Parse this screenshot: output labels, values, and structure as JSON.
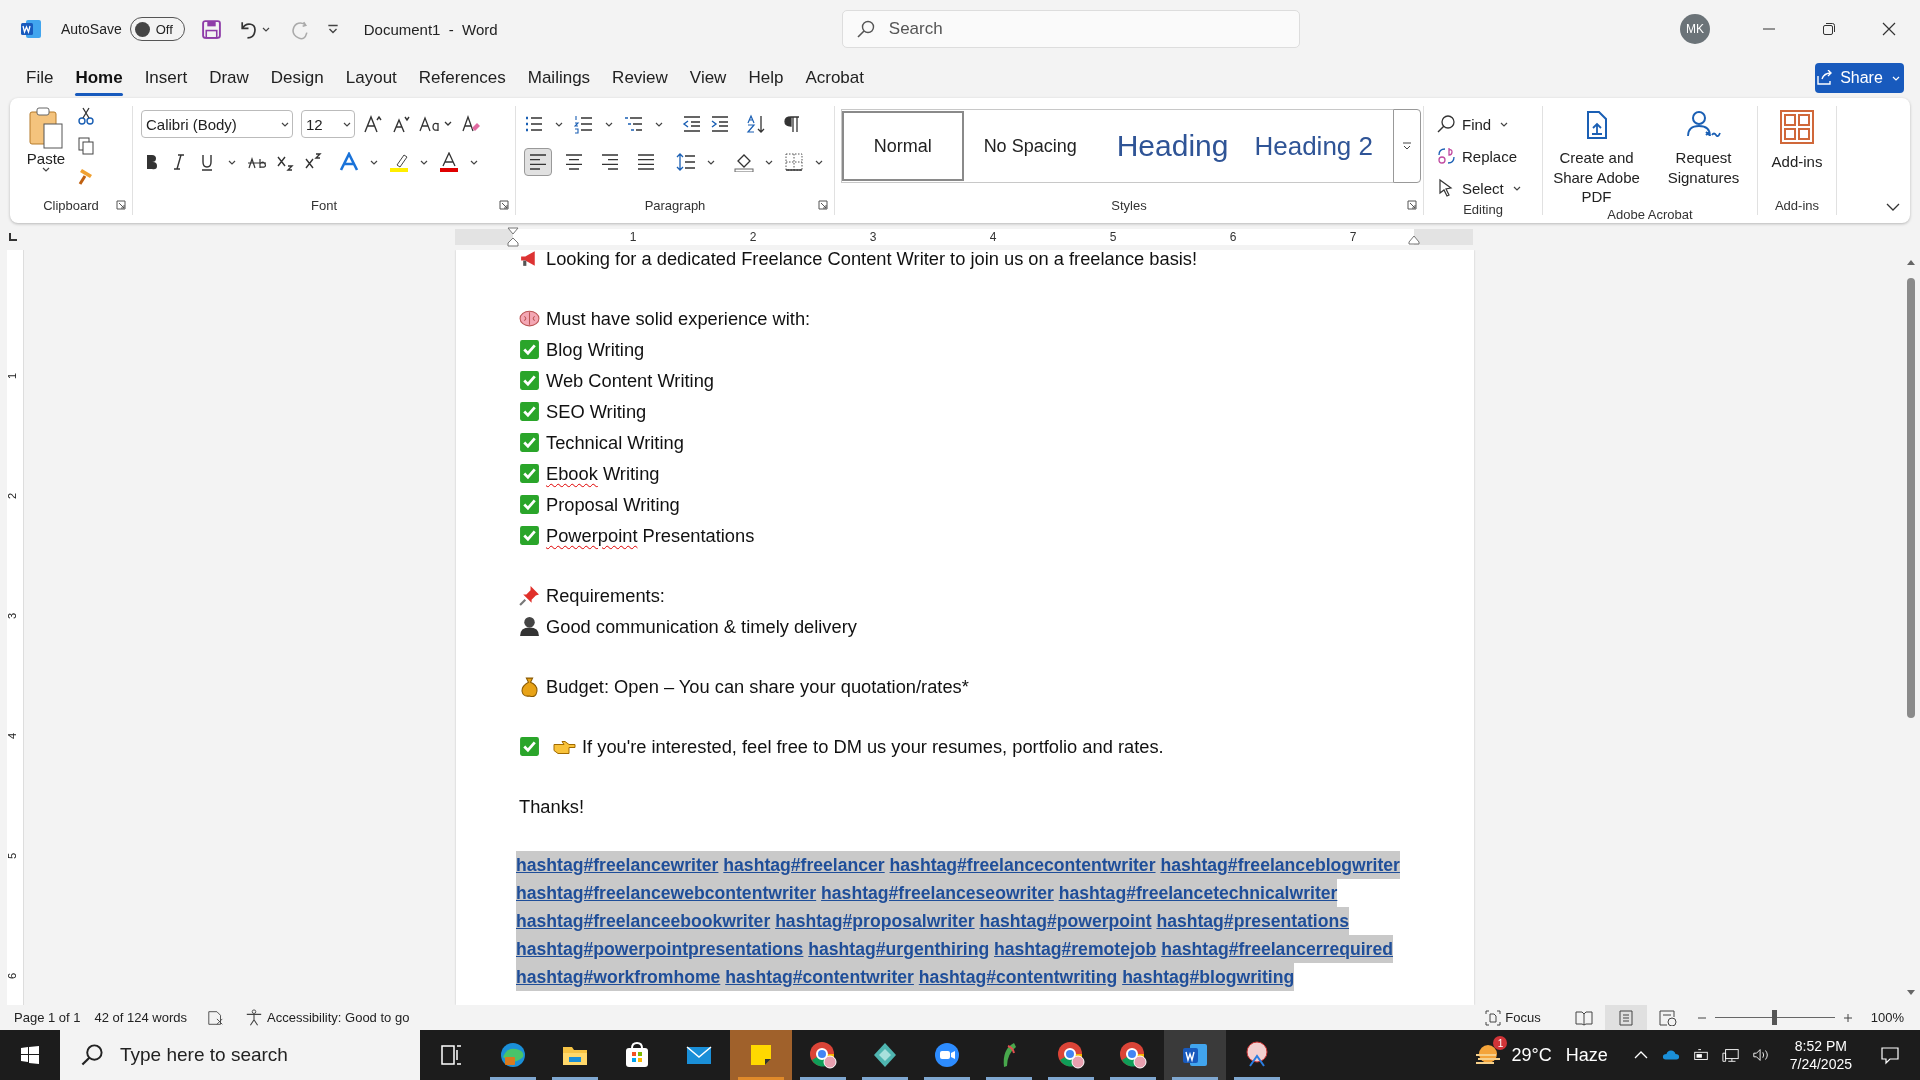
{
  "title_bar": {
    "autosave_label": "AutoSave",
    "autosave": {
      "label": "Off",
      "on": false
    },
    "document_title": "Document1  -  Word",
    "search": {
      "placeholder": "Search"
    },
    "avatar": "MK"
  },
  "menu_tabs": [
    {
      "label": "File",
      "selected": false
    },
    {
      "label": "Home",
      "selected": true
    },
    {
      "label": "Insert",
      "selected": false
    },
    {
      "label": "Draw",
      "selected": false
    },
    {
      "label": "Design",
      "selected": false
    },
    {
      "label": "Layout",
      "selected": false
    },
    {
      "label": "References",
      "selected": false
    },
    {
      "label": "Mailings",
      "selected": false
    },
    {
      "label": "Review",
      "selected": false
    },
    {
      "label": "View",
      "selected": false
    },
    {
      "label": "Help",
      "selected": false
    },
    {
      "label": "Acrobat",
      "selected": false
    }
  ],
  "share_button": "Share",
  "ribbon": {
    "clipboard": {
      "paste": "Paste",
      "label": "Clipboard"
    },
    "font": {
      "font_name": "Calibri (Body)",
      "font_size": "12",
      "label": "Font"
    },
    "paragraph": {
      "label": "Paragraph",
      "alignments": [
        {
          "kind": "left",
          "selected": true
        },
        {
          "kind": "center",
          "selected": false
        },
        {
          "kind": "right",
          "selected": false
        },
        {
          "kind": "justify",
          "selected": false
        }
      ]
    },
    "styles": {
      "label": "Styles",
      "items": [
        {
          "label": "Normal",
          "kind": "body",
          "selected": true
        },
        {
          "label": "No Spacing",
          "kind": "body",
          "selected": false
        },
        {
          "label": "Heading",
          "kind": "heading1",
          "selected": false
        },
        {
          "label": "Heading 2",
          "kind": "heading2",
          "selected": false
        }
      ]
    },
    "editing": {
      "label": "Editing",
      "items": [
        {
          "label": "Find",
          "kind": "find"
        },
        {
          "label": "Replace",
          "kind": "replace"
        },
        {
          "label": "Select",
          "kind": "select"
        }
      ]
    },
    "acrobat": {
      "label": "Adobe Acrobat",
      "items": [
        {
          "label": "Create and Share Adobe PDF",
          "kind": "pdf"
        },
        {
          "label": "Request Signatures",
          "kind": "sign"
        }
      ]
    },
    "addins": {
      "button": "Add-ins",
      "label": "Add-ins"
    }
  },
  "ruler": {
    "numbers": [
      "1",
      "2",
      "3",
      "4",
      "5",
      "6",
      "7"
    ]
  },
  "vertical_ruler": {
    "numbers": [
      "1",
      "2",
      "3",
      "4",
      "5",
      "6"
    ]
  },
  "document": {
    "sections": [
      [
        {
          "kind": "megaphone",
          "segments": [
            {
              "text": "Looking for a dedicated Freelance Content Writer to join us on a freelance basis!",
              "misspelled": false
            }
          ]
        }
      ],
      [
        {
          "kind": "brain",
          "segments": [
            {
              "text": "Must have solid experience with:",
              "misspelled": false
            }
          ]
        },
        {
          "kind": "check",
          "segments": [
            {
              "text": "Blog Writing",
              "misspelled": false
            }
          ]
        },
        {
          "kind": "check",
          "segments": [
            {
              "text": "Web Content Writing",
              "misspelled": false
            }
          ]
        },
        {
          "kind": "check",
          "segments": [
            {
              "text": "SEO Writing",
              "misspelled": false
            }
          ]
        },
        {
          "kind": "check",
          "segments": [
            {
              "text": "Technical Writing",
              "misspelled": false
            }
          ]
        },
        {
          "kind": "check",
          "segments": [
            {
              "text": "Ebook",
              "misspelled": true
            },
            {
              "text": " Writing",
              "misspelled": false
            }
          ]
        },
        {
          "kind": "check",
          "segments": [
            {
              "text": "Proposal Writing",
              "misspelled": false
            }
          ]
        },
        {
          "kind": "check",
          "segments": [
            {
              "text": "Powerpoint",
              "misspelled": true
            },
            {
              "text": " Presentations",
              "misspelled": false
            }
          ]
        }
      ],
      [
        {
          "kind": "pin",
          "segments": [
            {
              "text": "Requirements:",
              "misspelled": false
            }
          ]
        },
        {
          "kind": "person",
          "segments": [
            {
              "text": "Good communication & timely delivery",
              "misspelled": false
            }
          ]
        }
      ],
      [
        {
          "kind": "bag",
          "segments": [
            {
              "text": "Budget: Open – You can share your quotation/rates*",
              "misspelled": false
            }
          ]
        }
      ],
      [
        {
          "kind": "check_hand",
          "segments": [
            {
              "text": "If you're interested, feel free to DM us your resumes, portfolio and rates.",
              "misspelled": false
            }
          ]
        }
      ],
      [
        {
          "kind": "plain",
          "segments": [
            {
              "text": "Thanks!",
              "misspelled": false
            }
          ]
        }
      ]
    ],
    "hashtags_selected": true,
    "hashtag_lines": [
      [
        " hashtag#freelancewriter",
        "hashtag#freelancer",
        "hashtag#freelancecontentwriter",
        "hashtag#freelanceblogwriter"
      ],
      [
        "hashtag#freelancewebcontentwriter",
        "hashtag#freelanceseowriter",
        "hashtag#freelancetechnicalwriter"
      ],
      [
        "hashtag#freelanceebookwriter",
        "hashtag#proposalwriter",
        "hashtag#powerpoint",
        "hashtag#presentations"
      ],
      [
        "hashtag#powerpointpresentations",
        "hashtag#urgenthiring",
        "hashtag#remotejob",
        "hashtag#freelancerrequired"
      ],
      [
        "hashtag#workfromhome",
        "hashtag#contentwriter",
        "hashtag#contentwriting",
        "hashtag#blogwriting"
      ]
    ]
  },
  "status_bar": {
    "page": "Page 1 of 1",
    "words": "42 of 124 words",
    "accessibility": "Accessibility: Good to go",
    "focus": "Focus",
    "views": [
      {
        "kind": "read",
        "selected": false
      },
      {
        "kind": "print",
        "selected": true
      },
      {
        "kind": "web",
        "selected": false
      }
    ],
    "zoom_slider": {
      "level": 0.5
    },
    "zoom": "100%"
  },
  "taskbar": {
    "search": {
      "placeholder": "Type here to search"
    },
    "apps": [
      {
        "kind": "taskview",
        "running": false,
        "active": false,
        "attention": false
      },
      {
        "kind": "edge",
        "running": true,
        "active": false,
        "attention": false
      },
      {
        "kind": "explorer",
        "running": true,
        "active": false,
        "attention": false
      },
      {
        "kind": "store",
        "running": false,
        "active": false,
        "attention": false
      },
      {
        "kind": "mail",
        "running": false,
        "active": false,
        "attention": false
      },
      {
        "kind": "sticky",
        "running": true,
        "active": false,
        "attention": true
      },
      {
        "kind": "chrome",
        "running": true,
        "active": false,
        "attention": false
      },
      {
        "kind": "diamond",
        "running": true,
        "active": false,
        "attention": false
      },
      {
        "kind": "zoom",
        "running": true,
        "active": false,
        "attention": false
      },
      {
        "kind": "feather",
        "running": true,
        "active": false,
        "attention": false
      },
      {
        "kind": "chrome",
        "running": true,
        "active": false,
        "attention": false
      },
      {
        "kind": "chrome",
        "running": true,
        "active": false,
        "attention": false
      },
      {
        "kind": "word",
        "running": true,
        "active": true,
        "attention": false
      },
      {
        "kind": "snip",
        "running": true,
        "active": false,
        "attention": false
      }
    ],
    "weather_badge": "1",
    "temperature": "29°C",
    "weather": "Haze",
    "time": "8:52 PM",
    "date": "7/24/2025"
  }
}
